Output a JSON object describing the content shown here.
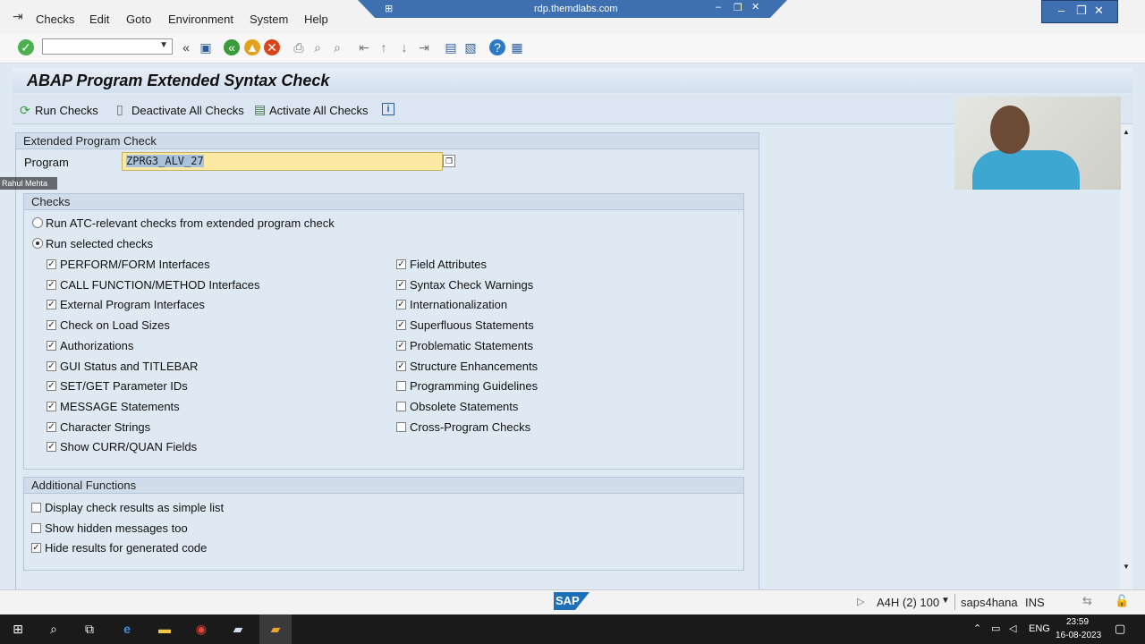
{
  "menu": [
    "Checks",
    "Edit",
    "Goto",
    "Environment",
    "System",
    "Help"
  ],
  "remote_title": "rdp.themdlabs.com",
  "title": "ABAP Program Extended Syntax Check",
  "app_toolbar": {
    "run": "Run Checks",
    "deactivate": "Deactivate All Checks",
    "activate": "Activate All Checks"
  },
  "program_group": {
    "header": "Extended Program Check",
    "label": "Program",
    "value": "ZPRG3_ALV_27"
  },
  "checks_group": {
    "header": "Checks",
    "radio_atc": "Run ATC-relevant checks from extended program check",
    "radio_selected": "Run selected checks",
    "left": [
      {
        "label": "PERFORM/FORM Interfaces",
        "checked": true
      },
      {
        "label": "CALL FUNCTION/METHOD Interfaces",
        "checked": true
      },
      {
        "label": "External Program Interfaces",
        "checked": true
      },
      {
        "label": "Check on Load Sizes",
        "checked": true
      },
      {
        "label": "Authorizations",
        "checked": true
      },
      {
        "label": "GUI Status and TITLEBAR",
        "checked": true
      },
      {
        "label": "SET/GET Parameter IDs",
        "checked": true
      },
      {
        "label": "MESSAGE Statements",
        "checked": true
      },
      {
        "label": "Character Strings",
        "checked": true
      },
      {
        "label": "Show CURR/QUAN Fields",
        "checked": true
      }
    ],
    "right": [
      {
        "label": "Field Attributes",
        "checked": true
      },
      {
        "label": "Syntax Check Warnings",
        "checked": true
      },
      {
        "label": "Internationalization",
        "checked": true
      },
      {
        "label": "Superfluous Statements",
        "checked": true
      },
      {
        "label": "Problematic Statements",
        "checked": true
      },
      {
        "label": "Structure Enhancements",
        "checked": true
      },
      {
        "label": "Programming Guidelines",
        "checked": false
      },
      {
        "label": "Obsolete Statements",
        "checked": false
      },
      {
        "label": "Cross-Program Checks",
        "checked": false
      }
    ]
  },
  "additional_group": {
    "header": "Additional Functions",
    "items": [
      {
        "label": "Display check results as simple list",
        "checked": false
      },
      {
        "label": "Show hidden messages too",
        "checked": false
      },
      {
        "label": "Hide results for generated code",
        "checked": true
      }
    ]
  },
  "status": {
    "logo": "SAP",
    "system": "A4H (2) 100",
    "server": "saps4hana",
    "mode": "INS"
  },
  "webcam_name": "Rahul Mehta",
  "taskbar": {
    "lang": "ENG",
    "time": "23:59",
    "date": "16-08-2023"
  }
}
